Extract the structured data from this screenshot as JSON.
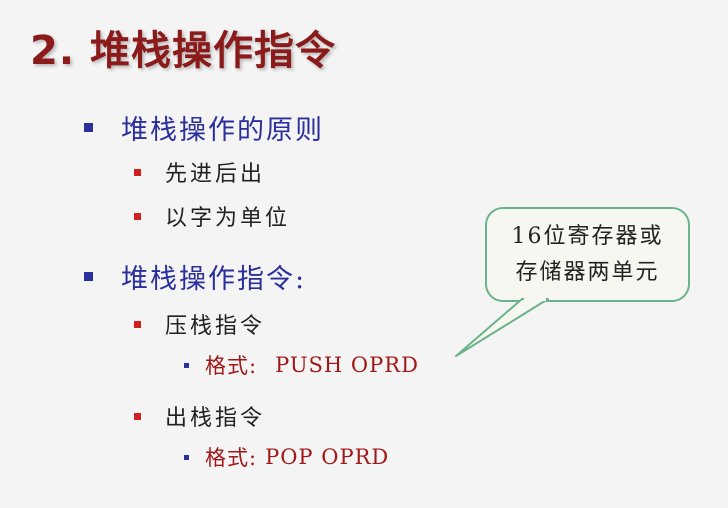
{
  "title": "2. 堆栈操作指令",
  "section1": {
    "heading": "堆栈操作的原则",
    "items": [
      "先进后出",
      "以字为单位"
    ]
  },
  "section2": {
    "heading": "堆栈操作指令:",
    "push": {
      "label": "压栈指令",
      "format_label": "格式:",
      "format_cmd": "PUSH OPRD"
    },
    "pop": {
      "label": "出栈指令",
      "format_label": "格式:",
      "format_cmd": "POP OPRD"
    }
  },
  "callout": {
    "line1": "16位寄存器或",
    "line2": "存储器两单元"
  },
  "colors": {
    "title": "#8b1a1a",
    "level1": "#2b2f9c",
    "level2_bullet": "#d02020",
    "format_text": "#a21818",
    "callout_border": "#6bb38a"
  }
}
